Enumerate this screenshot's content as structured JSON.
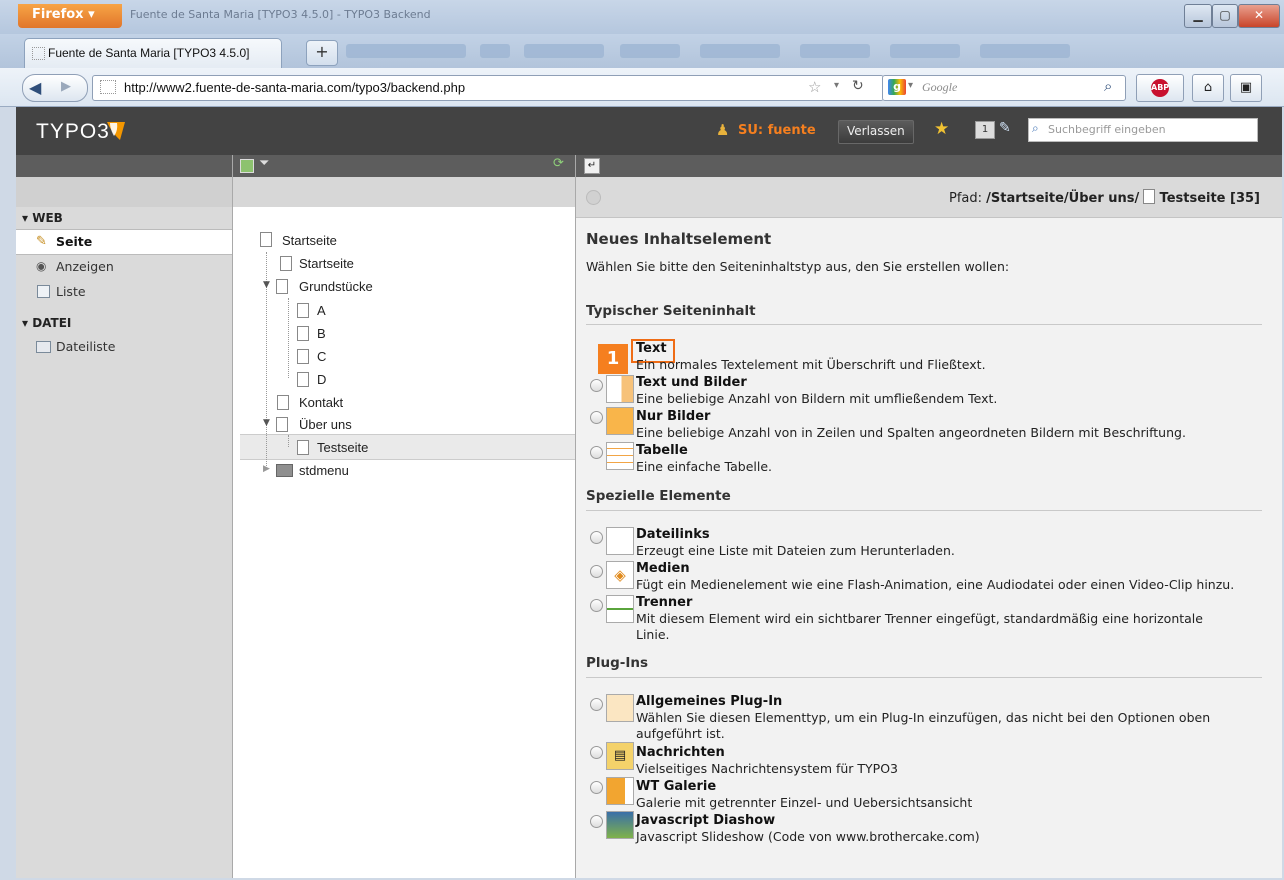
{
  "browser": {
    "menu_button": "Firefox",
    "window_title": "Fuente de Santa Maria [TYPO3 4.5.0] - TYPO3 Backend",
    "tab_title": "Fuente de Santa Maria [TYPO3 4.5.0]",
    "new_tab": "+",
    "url": "http://www2.fuente-de-santa-maria.com/typo3/backend.php",
    "search_placeholder": "Google"
  },
  "typo3": {
    "logo": "TYPO3",
    "su_label": "SU: fuente",
    "logout_button": "Verlassen",
    "search_placeholder": "Suchbegriff eingeben"
  },
  "modules": {
    "groups": [
      {
        "label": "WEB",
        "items": [
          {
            "label": "Seite",
            "icon": "edit-page-icon",
            "selected": true
          },
          {
            "label": "Anzeigen",
            "icon": "view-eye-icon"
          },
          {
            "label": "Liste",
            "icon": "list-icon"
          }
        ]
      },
      {
        "label": "DATEI",
        "items": [
          {
            "label": "Dateiliste",
            "icon": "folder-list-icon"
          }
        ]
      }
    ]
  },
  "tree": {
    "items": [
      {
        "label": "Startseite",
        "level": 0
      },
      {
        "label": "Startseite",
        "level": 1
      },
      {
        "label": "Grundstücke",
        "level": 1
      },
      {
        "label": "A",
        "level": 2
      },
      {
        "label": "B",
        "level": 2
      },
      {
        "label": "C",
        "level": 2
      },
      {
        "label": "D",
        "level": 2
      },
      {
        "label": "Kontakt",
        "level": 1
      },
      {
        "label": "Über uns",
        "level": 1
      },
      {
        "label": "Testseite",
        "level": 2,
        "selected": true
      },
      {
        "label": "stdmenu",
        "level": 1
      }
    ]
  },
  "content": {
    "path_label": "Pfad:",
    "path_value": "/Startseite/Über uns/",
    "path_page": "Testseite [35]",
    "heading": "Neues Inhaltselement",
    "intro": "Wählen Sie bitte den Seiteninhaltstyp aus, den Sie erstellen wollen:",
    "step_marker": "1",
    "sections": [
      {
        "title": "Typischer Seiteninhalt",
        "elements": [
          {
            "title": "Text",
            "desc": "Ein normales Textelement mit Überschrift und Fließtext."
          },
          {
            "title": "Text und Bilder",
            "desc": "Eine beliebige Anzahl von Bildern mit umfließendem Text."
          },
          {
            "title": "Nur Bilder",
            "desc": "Eine beliebige Anzahl von in Zeilen und Spalten angeordneten Bildern mit Beschriftung."
          },
          {
            "title": "Tabelle",
            "desc": "Eine einfache Tabelle."
          }
        ]
      },
      {
        "title": "Spezielle Elemente",
        "elements": [
          {
            "title": "Dateilinks",
            "desc": "Erzeugt eine Liste mit Dateien zum Herunterladen."
          },
          {
            "title": "Medien",
            "desc": "Fügt ein Medienelement wie eine Flash-Animation, eine Audiodatei oder einen Video-Clip hinzu."
          },
          {
            "title": "Trenner",
            "desc": "Mit diesem Element wird ein sichtbarer Trenner eingefügt, standardmäßig eine horizontale",
            "desc2": "Linie."
          }
        ]
      },
      {
        "title": "Plug-Ins",
        "elements": [
          {
            "title": "Allgemeines Plug-In",
            "desc": "Wählen Sie diesen Elementtyp, um ein Plug-In einzufügen, das nicht bei den Optionen oben",
            "desc2": "aufgeführt ist."
          },
          {
            "title": "Nachrichten",
            "desc": "Vielseitiges Nachrichtensystem für TYPO3"
          },
          {
            "title": "WT Galerie",
            "desc": "Galerie mit getrennter Einzel- und Uebersichtsansicht"
          },
          {
            "title": "Javascript Diashow",
            "desc": "Javascript Slideshow (Code von www.brothercake.com)"
          }
        ]
      }
    ]
  }
}
